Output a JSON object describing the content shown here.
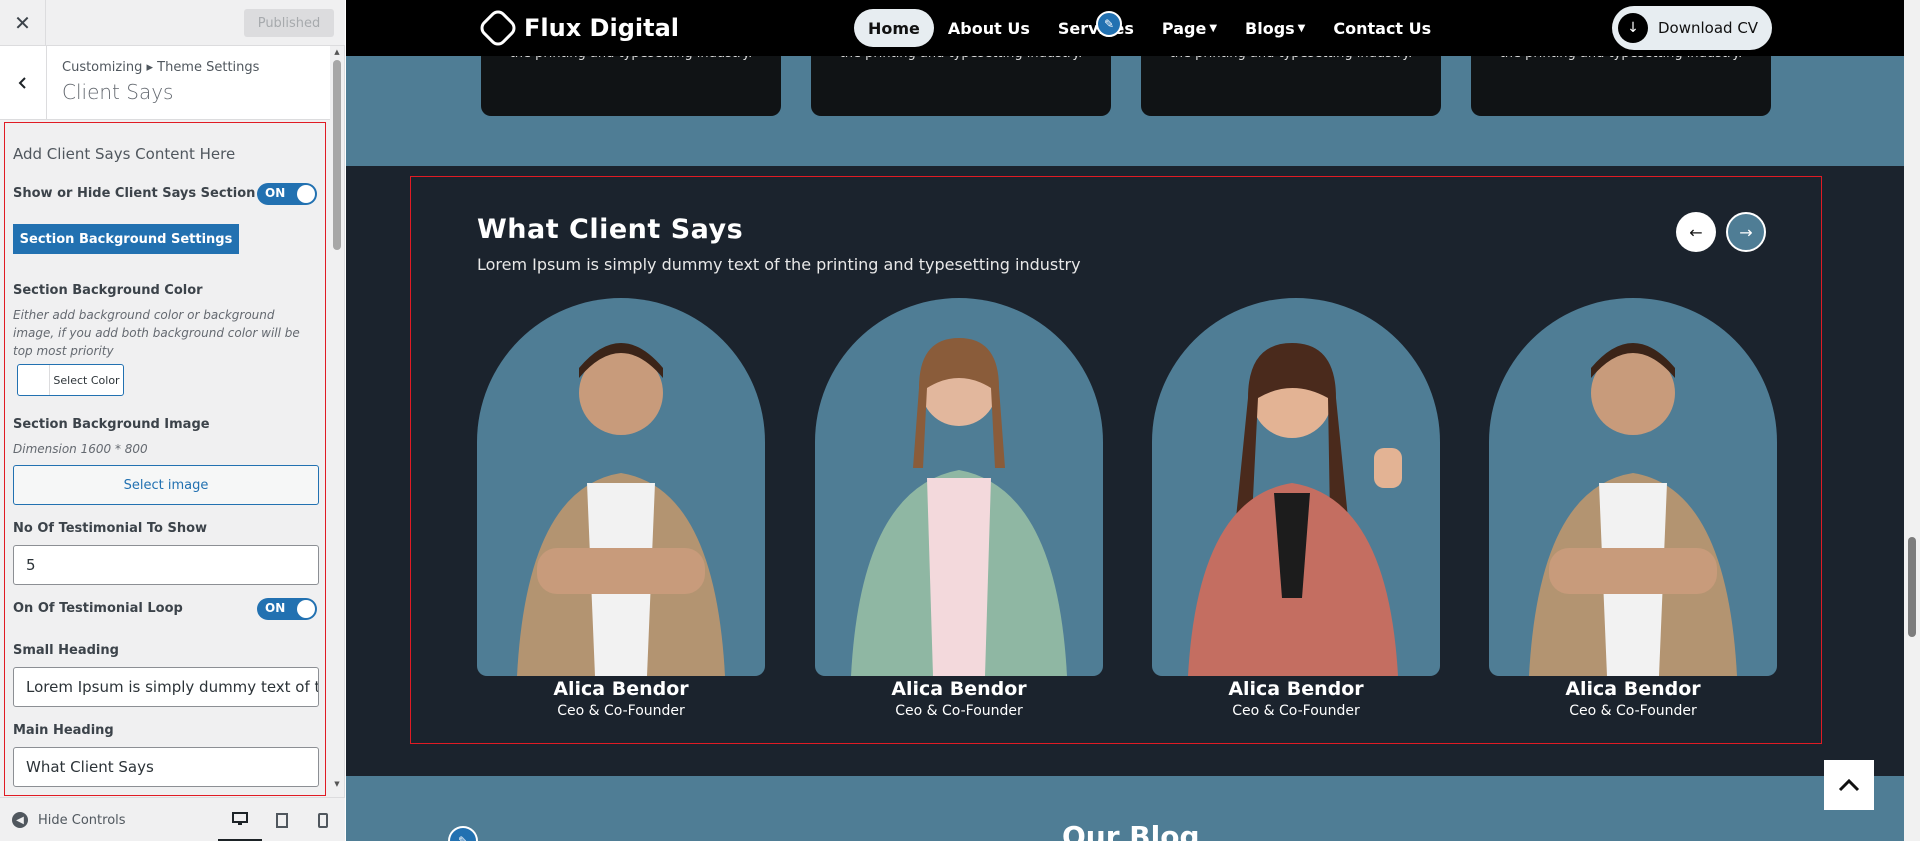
{
  "sidebar": {
    "close_icon": "✕",
    "published_label": "Published",
    "back_icon": "‹",
    "breadcrumb": "Customizing ▸ Theme Settings",
    "section_title": "Client Says",
    "intro": "Add Client Says Content Here",
    "show_hide_label": "Show or Hide Client Says Section",
    "show_hide_toggle": "ON",
    "bg_settings_button": "Section Background Settings",
    "bg_color_label": "Section Background Color",
    "bg_color_desc": "Either add background color or background image, if you add both background color will be top most priority",
    "select_color_label": "Select Color",
    "bg_image_label": "Section Background Image",
    "bg_image_desc": "Dimension 1600 * 800",
    "select_image_label": "Select image",
    "testimonial_count_label": "No Of Testimonial To Show",
    "testimonial_count_value": "5",
    "loop_label": "On Of Testimonial Loop",
    "loop_toggle": "ON",
    "small_heading_label": "Small Heading",
    "small_heading_value": "Lorem Ipsum is simply dummy text of t",
    "main_heading_label": "Main Heading",
    "main_heading_value": "What Client Says",
    "hide_controls_label": "Hide Controls",
    "devices": [
      "desktop-icon",
      "tablet-icon",
      "mobile-icon"
    ]
  },
  "preview": {
    "card_text": "the printing and typesetting industry.",
    "brand": "Flux Digital",
    "nav": [
      "Home",
      "About Us",
      "Services",
      "Page",
      "Blogs",
      "Contact Us"
    ],
    "download_cv": "Download CV",
    "client_says": {
      "title": "What Client Says",
      "subtitle": "Lorem Ipsum is simply dummy text of the printing and typesetting industry",
      "prev_icon": "←",
      "next_icon": "→",
      "members": [
        {
          "name": "Alica Bendor",
          "role": "Ceo & Co-Founder"
        },
        {
          "name": "Alica Bendor",
          "role": "Ceo & Co-Founder"
        },
        {
          "name": "Alica Bendor",
          "role": "Ceo & Co-Founder"
        },
        {
          "name": "Alica Bendor",
          "role": "Ceo & Co-Founder"
        }
      ]
    },
    "blog_title": "Our Blog"
  },
  "colors": {
    "accent": "#2271b1",
    "preview_bg": "#4f7d95",
    "section_bg": "#1b232d",
    "highlight": "#e01b24"
  }
}
